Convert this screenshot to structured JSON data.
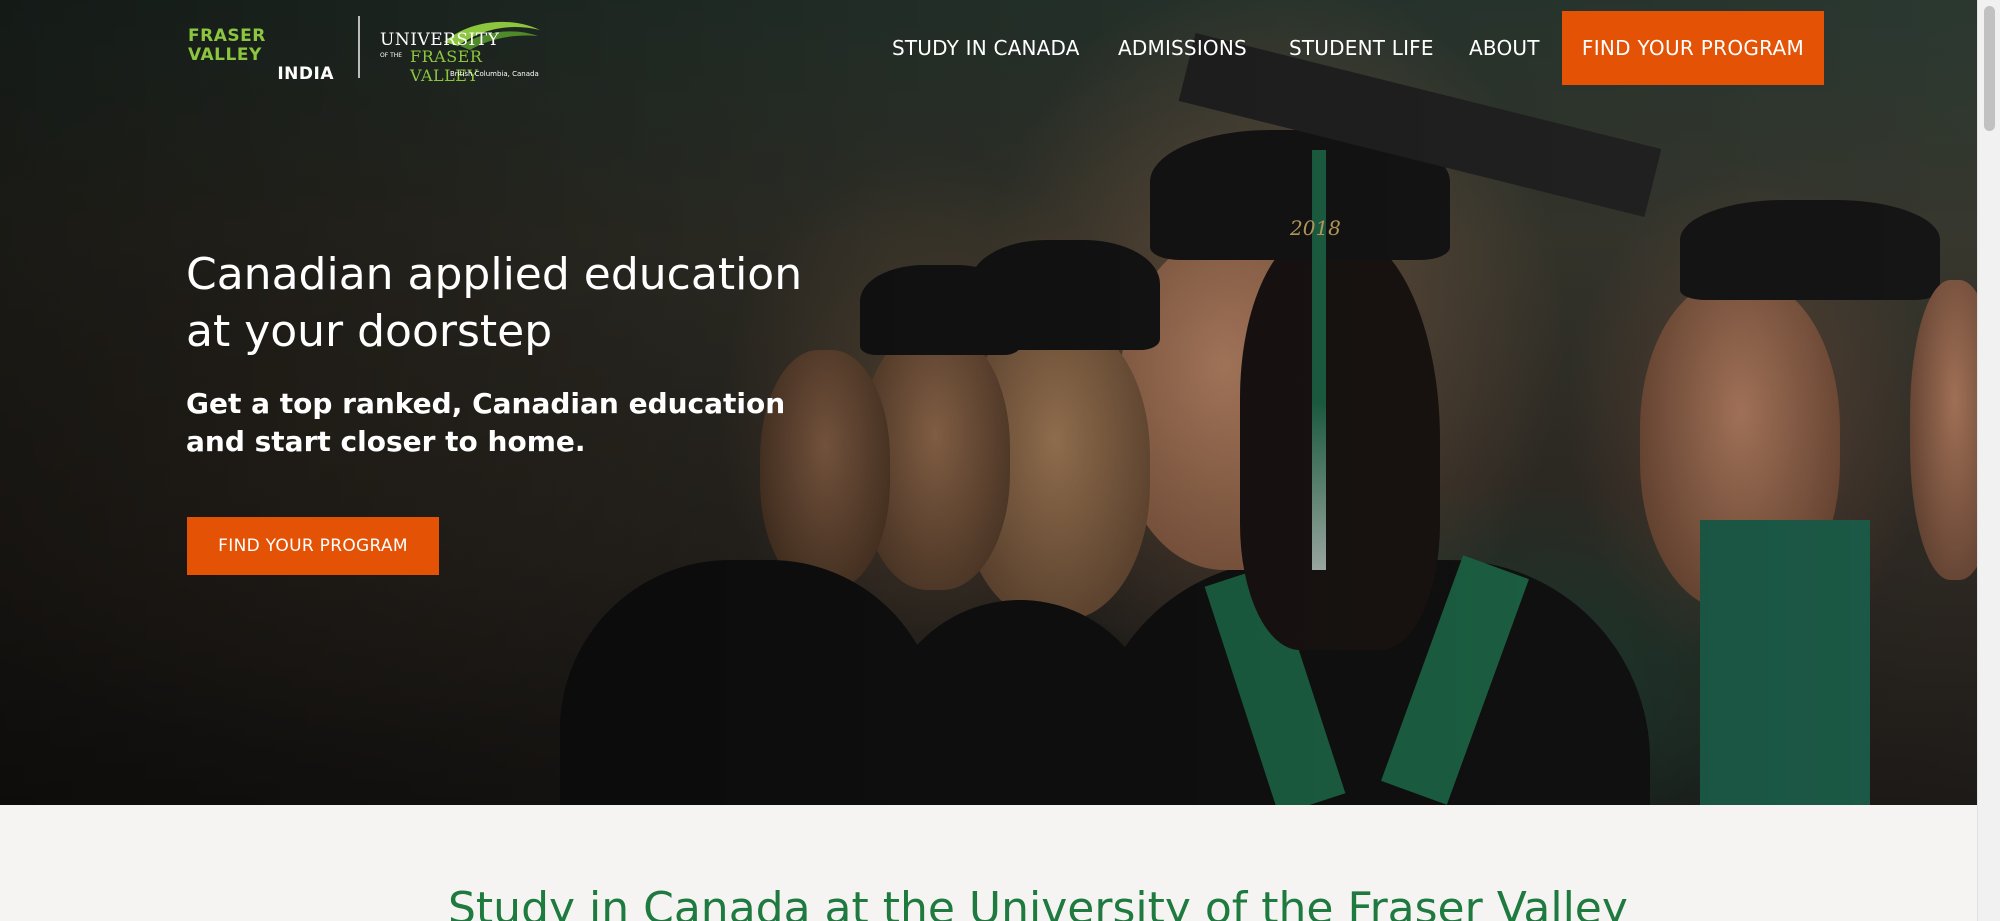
{
  "brand": {
    "fv_line1": "FRASER VALLEY",
    "fv_line2": "INDIA",
    "ufv_university": "UNIVERSITY",
    "ufv_of_the": "OF THE",
    "ufv_fraser_valley": "FRASER VALLEY",
    "ufv_location": "British Columbia, Canada",
    "green": "#8cc63f"
  },
  "nav": {
    "items": [
      "STUDY IN CANADA",
      "ADMISSIONS",
      "STUDENT LIFE",
      "ABOUT"
    ],
    "cta_label": "FIND YOUR PROGRAM",
    "cta_color": "#e35205"
  },
  "hero": {
    "title": "Canadian applied education at your doorstep",
    "subtitle": "Get a top ranked, Canadian education and start closer to home.",
    "cta_label": "FIND YOUR PROGRAM",
    "cap_year": "2018"
  },
  "section": {
    "title": "Study in Canada at the University of the Fraser Valley",
    "title_color": "#1f7a3f"
  }
}
